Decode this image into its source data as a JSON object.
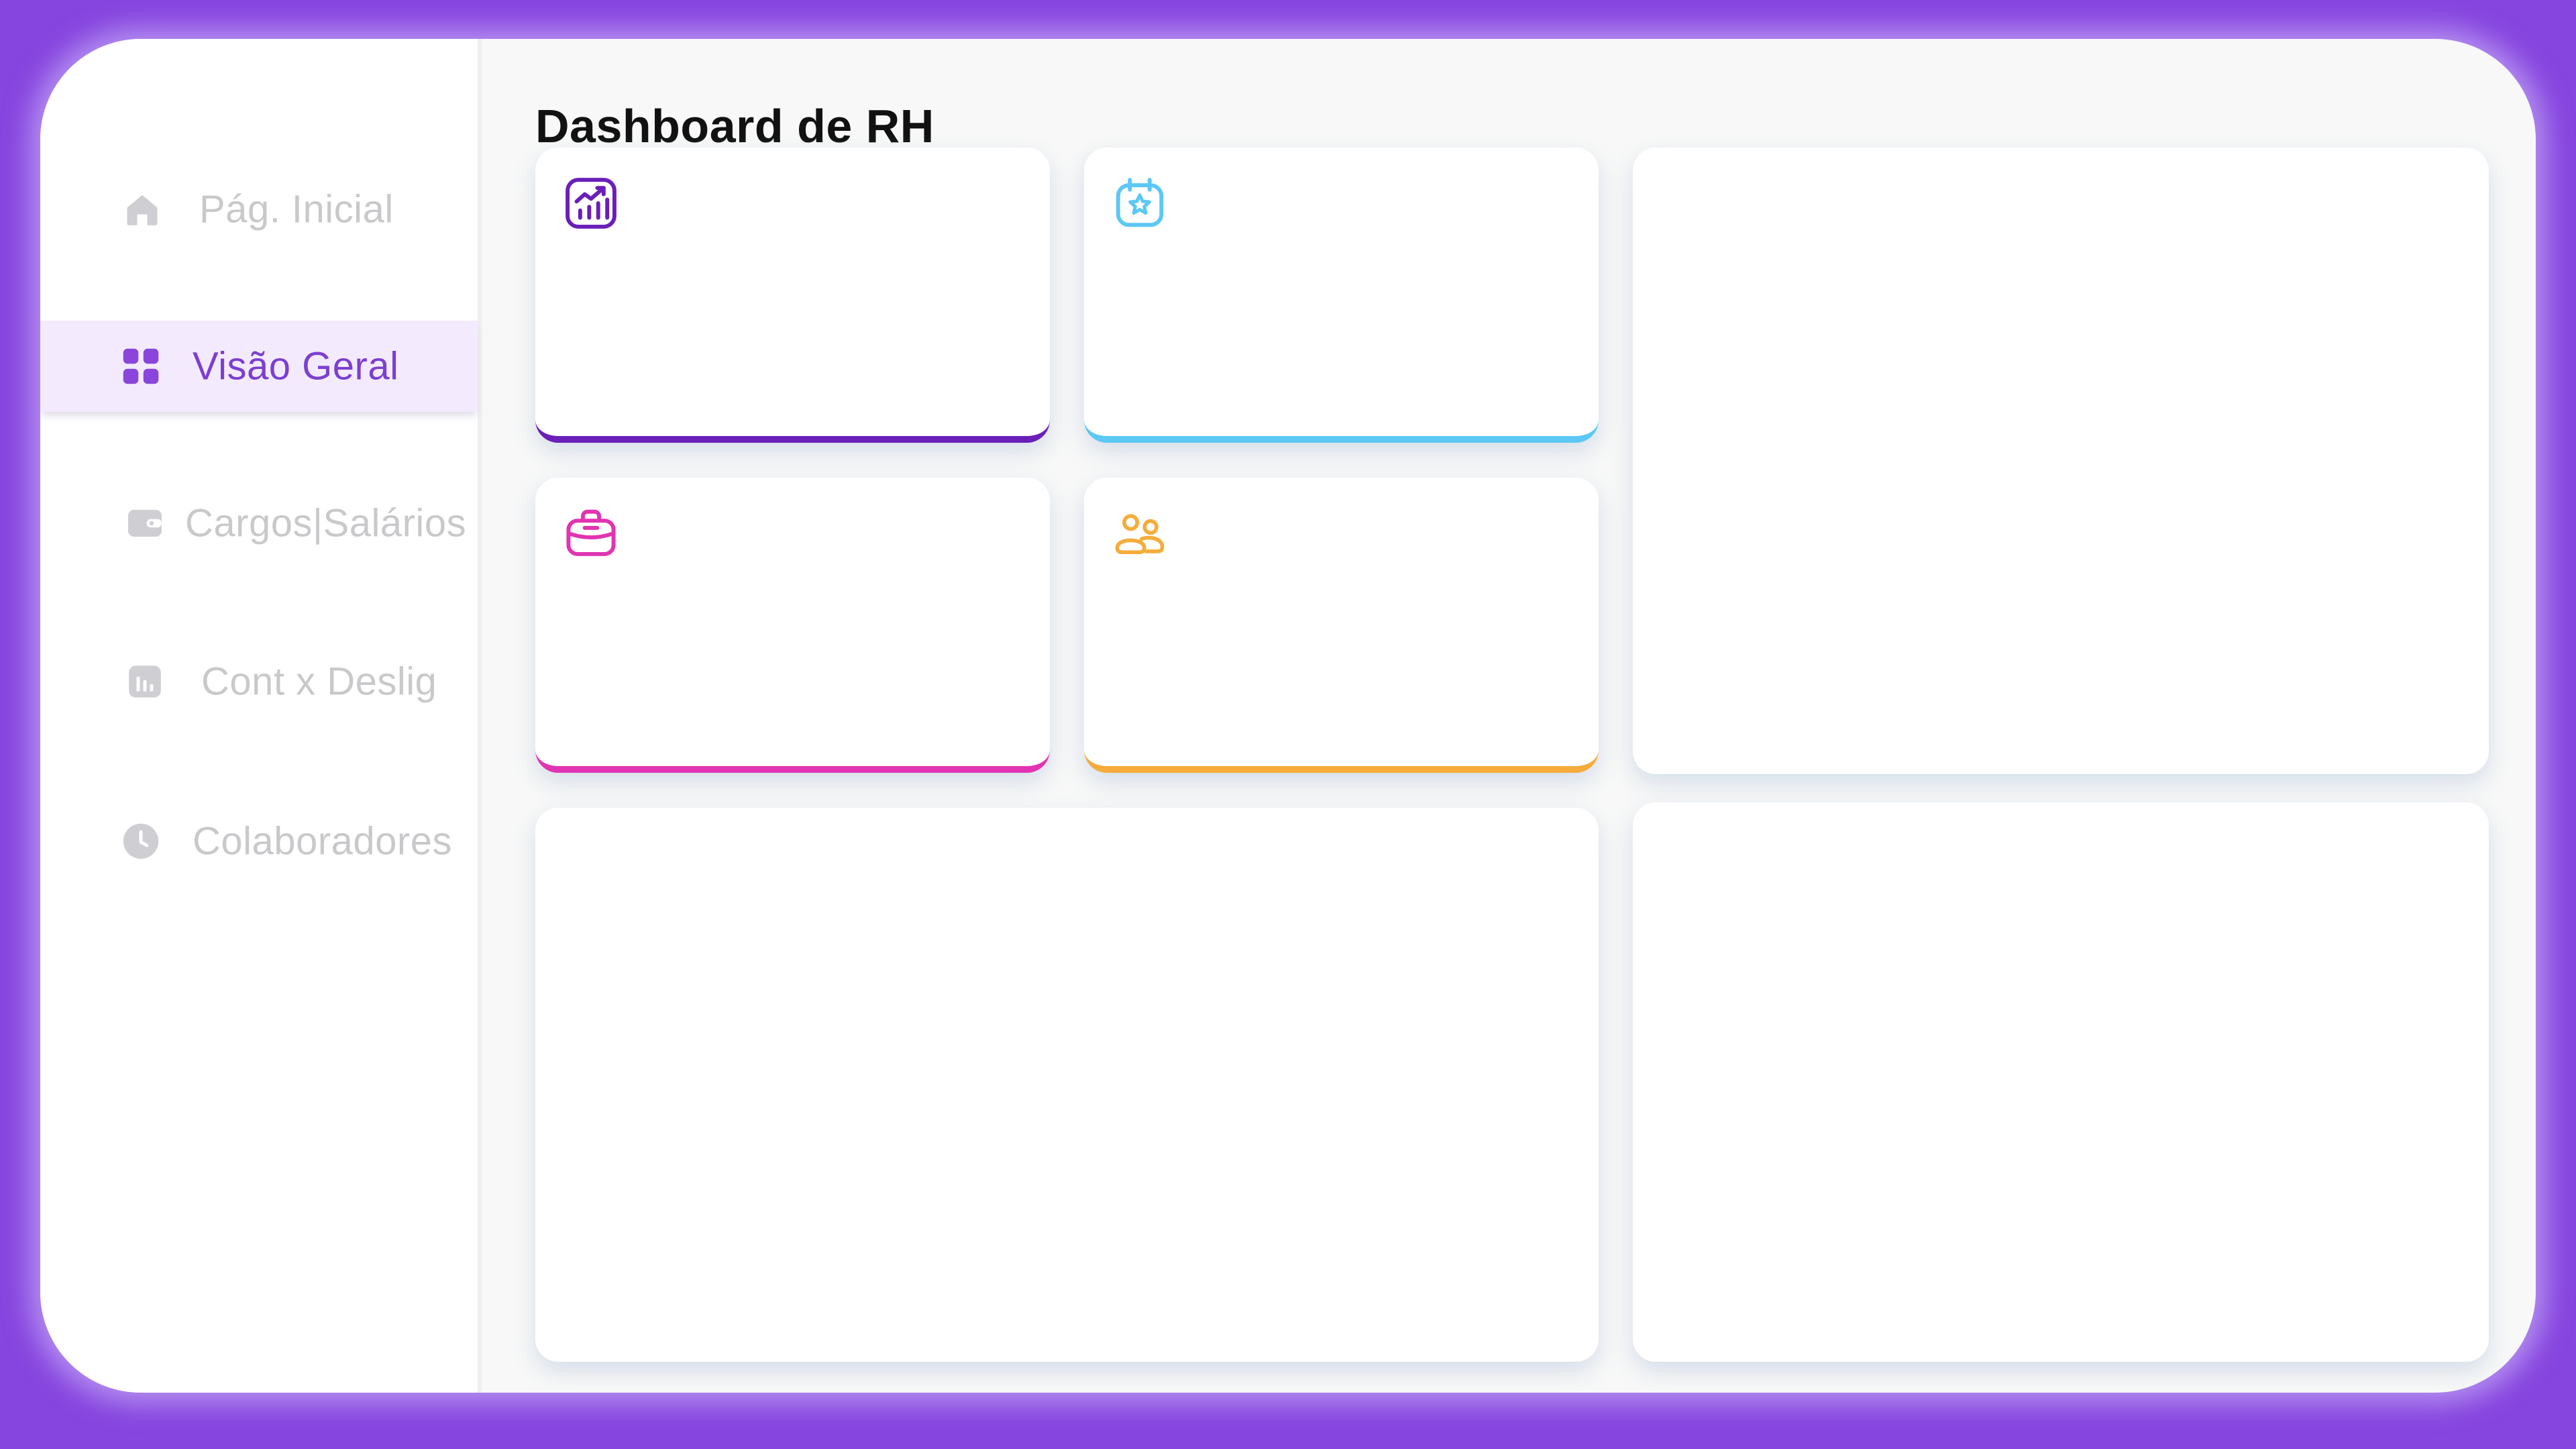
{
  "page": {
    "title": "Dashboard de RH"
  },
  "sidebar": {
    "items": [
      {
        "label": "Pág. Inicial",
        "icon": "home-icon",
        "active": false
      },
      {
        "label": "Visão Geral",
        "icon": "grid-icon",
        "active": true
      },
      {
        "label": "Cargos|Salários",
        "icon": "wallet-icon",
        "active": false
      },
      {
        "label": "Cont x Deslig",
        "icon": "bar-chart-icon",
        "active": false
      },
      {
        "label": "Colaboradores",
        "icon": "clock-icon",
        "active": false
      }
    ]
  },
  "kpi_cards": [
    {
      "icon": "analytics-chart-icon",
      "accent": "#6a1fb8"
    },
    {
      "icon": "calendar-star-icon",
      "accent": "#5cc8f5"
    },
    {
      "icon": "briefcase-icon",
      "accent": "#e034b2"
    },
    {
      "icon": "users-icon",
      "accent": "#f5ac3b"
    }
  ],
  "colors": {
    "background": "#8645df",
    "frame": "#f8f8f8",
    "sidebar": "#ffffff",
    "active_item_bg": "#f3ebfd",
    "active_item_text": "#7c3fd0",
    "inactive_item_text": "#c9c9cc"
  }
}
